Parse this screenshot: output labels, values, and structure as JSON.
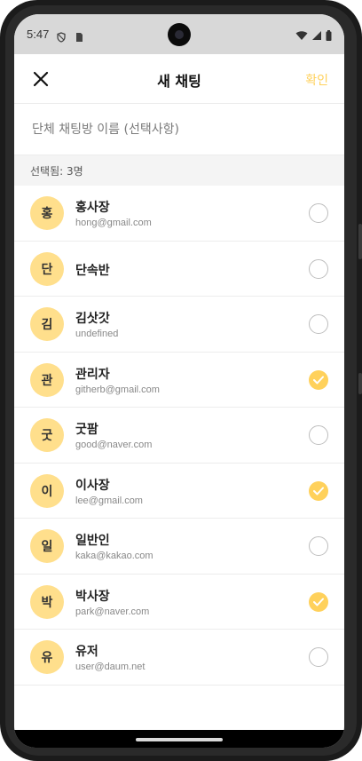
{
  "status_bar": {
    "time": "5:47"
  },
  "header": {
    "title": "새 채팅",
    "confirm_label": "확인"
  },
  "name_input": {
    "placeholder": "단체 채팅방 이름 (선택사항)"
  },
  "selected_label": "선택됨: 3명",
  "colors": {
    "accent": "#ffd15b",
    "avatar_bg": "#ffdf8c"
  },
  "contacts": [
    {
      "initial": "홍",
      "name": "홍사장",
      "email": "hong@gmail.com",
      "selected": false
    },
    {
      "initial": "단",
      "name": "단속반",
      "email": "",
      "selected": false
    },
    {
      "initial": "김",
      "name": "김삿갓",
      "email": "undefined",
      "selected": false
    },
    {
      "initial": "관",
      "name": "관리자",
      "email": "githerb@gmail.com",
      "selected": true
    },
    {
      "initial": "굿",
      "name": "굿팜",
      "email": "good@naver.com",
      "selected": false
    },
    {
      "initial": "이",
      "name": "이사장",
      "email": "lee@gmail.com",
      "selected": true
    },
    {
      "initial": "일",
      "name": "일반인",
      "email": "kaka@kakao.com",
      "selected": false
    },
    {
      "initial": "박",
      "name": "박사장",
      "email": "park@naver.com",
      "selected": true
    },
    {
      "initial": "유",
      "name": "유저",
      "email": "user@daum.net",
      "selected": false
    }
  ]
}
